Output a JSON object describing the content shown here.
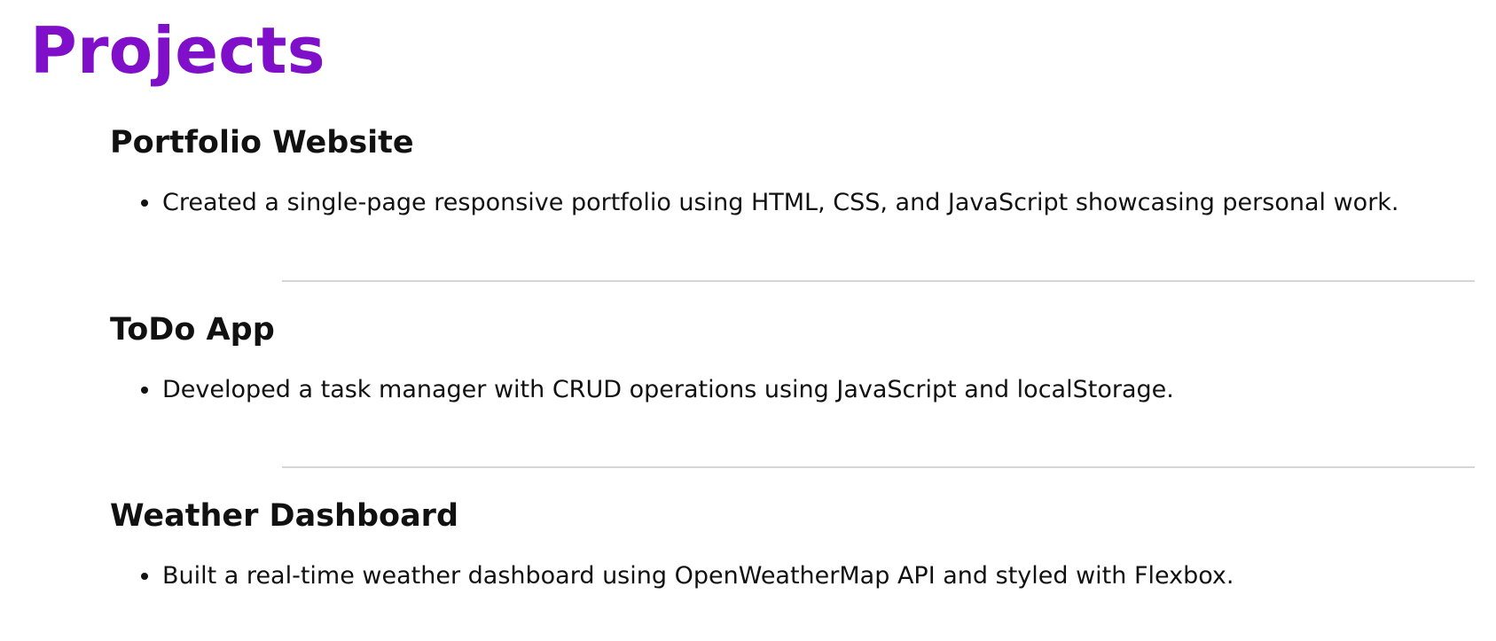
{
  "page": {
    "title": "Projects",
    "title_color": "#7f0fc8"
  },
  "projects": [
    {
      "title": "Portfolio Website",
      "items": [
        "Created a single-page responsive portfolio using HTML, CSS, and JavaScript showcasing personal work."
      ]
    },
    {
      "title": "ToDo App",
      "items": [
        "Developed a task manager with CRUD operations using JavaScript and localStorage."
      ]
    },
    {
      "title": "Weather Dashboard",
      "items": [
        "Built a real-time weather dashboard using OpenWeatherMap API and styled with Flexbox."
      ]
    }
  ]
}
